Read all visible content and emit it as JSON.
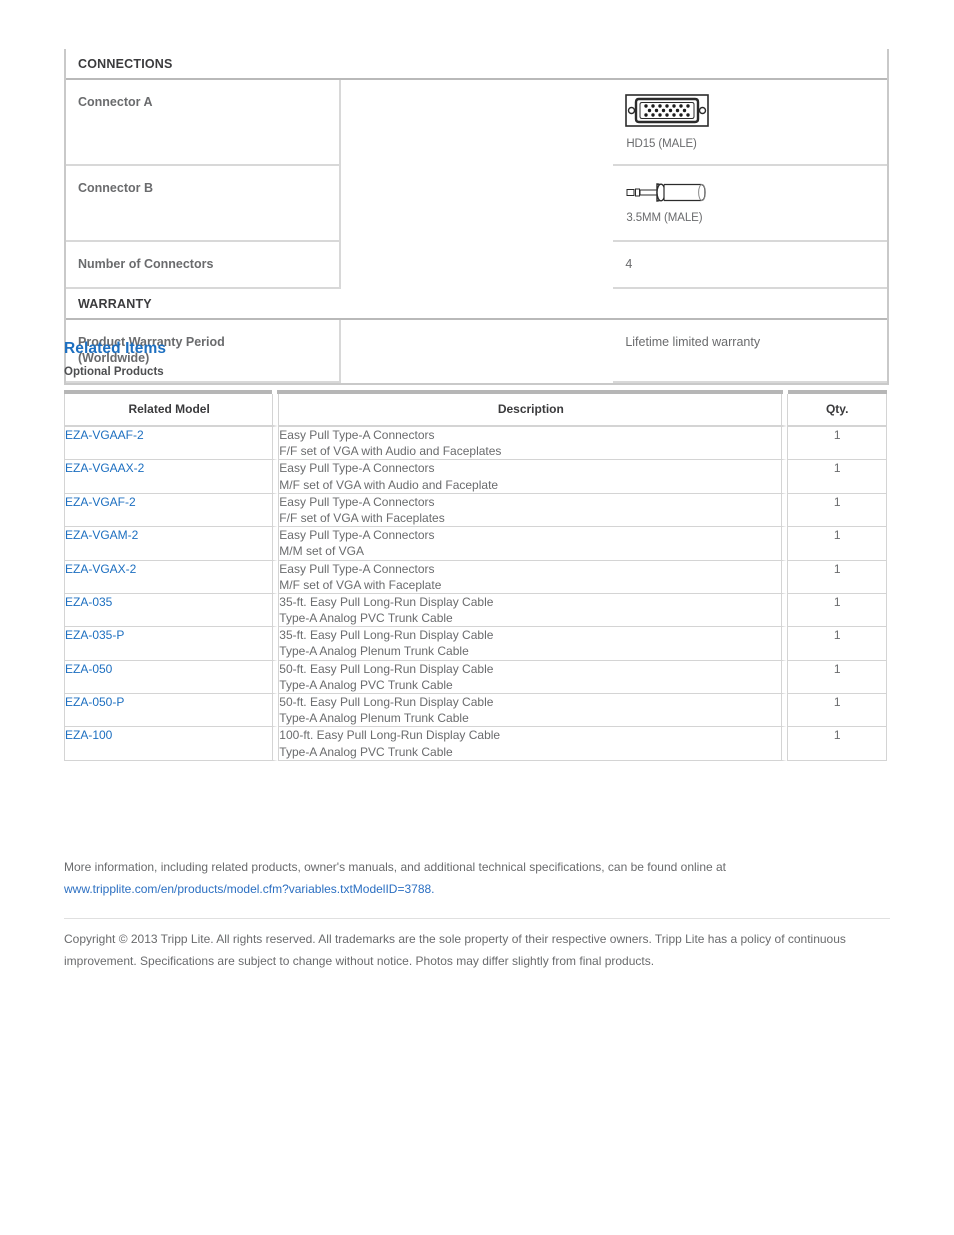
{
  "spec": {
    "sections": [
      {
        "title": "CONNECTIONS",
        "rows": [
          {
            "label": "Connector A",
            "value": "",
            "image": "hd15-connector-image",
            "caption": "HD15 (MALE)"
          },
          {
            "label": "Connector B",
            "value": "",
            "image": "3.5mm-connector-image",
            "caption": "3.5MM (MALE)"
          },
          {
            "label": "Number of Connectors",
            "value": "4",
            "image": null,
            "caption": null
          }
        ]
      },
      {
        "title": "WARRANTY",
        "rows": [
          {
            "label": "Product Warranty Period (Worldwide)",
            "label_line1": "Product Warranty Period",
            "label_line2": "(Worldwide)",
            "value": "Lifetime limited warranty",
            "image": null,
            "caption": null
          }
        ]
      }
    ]
  },
  "related": {
    "heading": "Related Items",
    "subheading": "Optional Products",
    "columns": {
      "model": "Related Model",
      "description": "Description",
      "qty": "Qty."
    },
    "rows": [
      {
        "model": "EZA-VGAAF-2",
        "desc1": "Easy Pull Type-A Connectors",
        "desc2": "F/F set of VGA with Audio and Faceplates",
        "qty": "1"
      },
      {
        "model": "EZA-VGAAX-2",
        "desc1": "Easy Pull Type-A Connectors",
        "desc2": "M/F set of VGA with Audio and Faceplate",
        "qty": "1"
      },
      {
        "model": "EZA-VGAF-2",
        "desc1": "Easy Pull Type-A Connectors",
        "desc2": "F/F set of VGA with Faceplates",
        "qty": "1"
      },
      {
        "model": "EZA-VGAM-2",
        "desc1": "Easy Pull Type-A Connectors",
        "desc2": "M/M set of VGA",
        "qty": "1"
      },
      {
        "model": "EZA-VGAX-2",
        "desc1": "Easy Pull Type-A Connectors",
        "desc2": "M/F set of VGA with Faceplate",
        "qty": "1"
      },
      {
        "model": "EZA-035",
        "desc1": "35-ft. Easy Pull Long-Run Display Cable",
        "desc2": "Type-A Analog PVC Trunk Cable",
        "qty": "1"
      },
      {
        "model": "EZA-035-P",
        "desc1": "35-ft. Easy Pull Long-Run Display Cable",
        "desc2": "Type-A Analog Plenum Trunk Cable",
        "qty": "1"
      },
      {
        "model": "EZA-050",
        "desc1": "50-ft. Easy Pull Long-Run Display Cable",
        "desc2": "Type-A Analog PVC Trunk Cable",
        "qty": "1"
      },
      {
        "model": "EZA-050-P",
        "desc1": "50-ft. Easy Pull Long-Run Display Cable",
        "desc2": "Type-A Analog Plenum Trunk Cable",
        "qty": "1"
      },
      {
        "model": "EZA-100",
        "desc1": "100-ft. Easy Pull Long-Run Display Cable",
        "desc2": "Type-A Analog PVC Trunk Cable",
        "qty": "1"
      }
    ]
  },
  "footer": {
    "more_info": "More information, including related products, owner's manuals, and additional technical specifications, can be found online at",
    "url": "www.tripplite.com/en/products/model.cfm?variables.txtModelID=3788.",
    "copyright": "Copyright © 2013 Tripp Lite. All rights reserved. All trademarks are the sole property of their respective owners. Tripp Lite has a policy of continuous improvement. Specifications are subject to change without notice. Photos may differ slightly from final products."
  },
  "colors": {
    "link": "#1d6fc0",
    "heading": "#1d6fc0",
    "text": "#6a6b6d",
    "border": "#d4d4d4",
    "header_strip": "#b6b6b6"
  }
}
